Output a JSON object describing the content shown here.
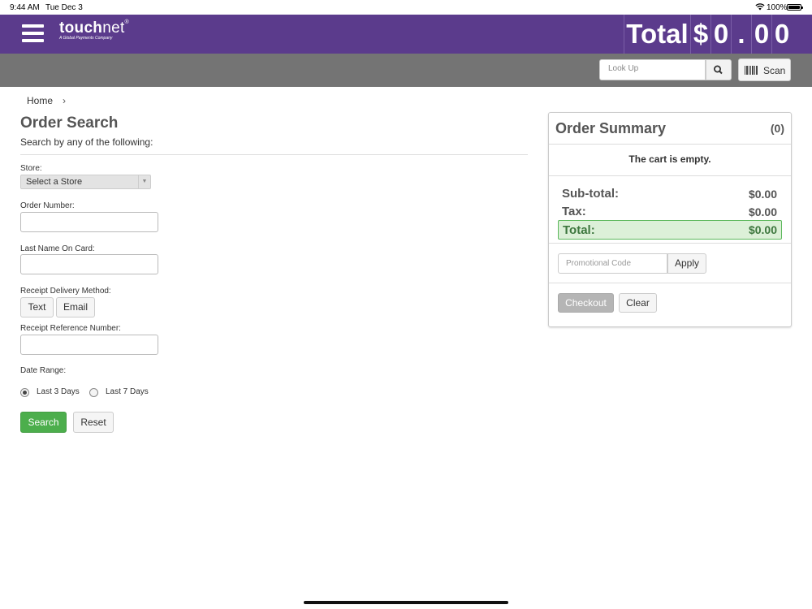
{
  "status_bar": {
    "time": "9:44 AM",
    "date": "Tue Dec 3",
    "battery": "100%"
  },
  "header": {
    "menu_icon": "hamburger-icon",
    "logo": {
      "brand_bold": "touch",
      "brand_light": "net",
      "trademark": "®",
      "tagline": "A Global Payments Company"
    },
    "total_label": "Total",
    "currency": "$",
    "total_digits": [
      "0",
      ".",
      "0",
      "0"
    ],
    "brand_color": "#5b3b8c"
  },
  "toolbar": {
    "lookup_placeholder": "Look Up",
    "lookup_icon": "search-icon",
    "scan_label": "Scan",
    "scan_icon": "barcode-icon"
  },
  "breadcrumb": {
    "home": "Home",
    "separator": "›"
  },
  "form": {
    "title": "Order Search",
    "subtitle": "Search by any of the following:",
    "store_label": "Store:",
    "store_value": "Select a Store",
    "order_number_label": "Order Number:",
    "last_name_label": "Last Name On Card:",
    "receipt_method_label": "Receipt Delivery Method:",
    "receipt_methods": [
      "Text",
      "Email"
    ],
    "receipt_ref_label": "Receipt Reference Number:",
    "date_range_label": "Date Range:",
    "date_options": [
      {
        "label": "Last 3 Days",
        "checked": true
      },
      {
        "label": "Last 7 Days",
        "checked": false
      }
    ],
    "search_label": "Search",
    "reset_label": "Reset",
    "search_color": "#4cae4c"
  },
  "summary": {
    "title": "Order Summary",
    "count": "(0)",
    "empty_text": "The cart is empty.",
    "subtotal_label": "Sub-total:",
    "subtotal_value": "$0.00",
    "tax_label": "Tax:",
    "tax_value": "$0.00",
    "total_label": "Total:",
    "total_value": "$0.00",
    "promo_placeholder": "Promotional Code",
    "apply_label": "Apply",
    "checkout_label": "Checkout",
    "clear_label": "Clear"
  }
}
